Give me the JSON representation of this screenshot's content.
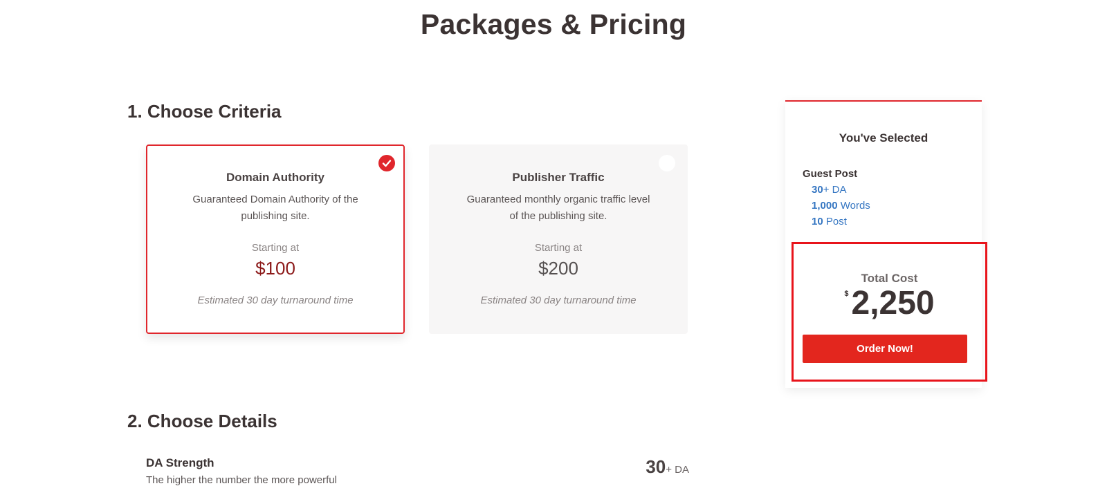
{
  "page": {
    "title": "Packages & Pricing"
  },
  "sections": {
    "criteria_title": "1. Choose Criteria",
    "details_title": "2. Choose Details"
  },
  "cards": [
    {
      "title": "Domain Authority",
      "description": "Guaranteed Domain Authority of the publishing site.",
      "starting_label": "Starting at",
      "price": "$100",
      "eta": "Estimated 30 day turnaround time",
      "selected": true,
      "check_icon": "checkmark-icon"
    },
    {
      "title": "Publisher Traffic",
      "description": "Guaranteed monthly organic traffic level of the publishing site.",
      "starting_label": "Starting at",
      "price": "$200",
      "eta": "Estimated 30 day turnaround time",
      "selected": false
    }
  ],
  "summary": {
    "title": "You've Selected",
    "product": "Guest Post",
    "lines": [
      {
        "value": "30",
        "unit": "+ DA"
      },
      {
        "value": "1,000",
        "unit": " Words"
      },
      {
        "value": "10",
        "unit": " Post"
      }
    ],
    "total_label": "Total Cost",
    "currency": "$",
    "total": "2,250",
    "order_button": "Order Now!"
  },
  "details": {
    "da_strength_label": "DA Strength",
    "da_strength_desc": "The higher the number the more powerful",
    "da_value": "30",
    "da_unit": "+ DA"
  },
  "colors": {
    "accent": "#e0262c",
    "link": "#3576c2",
    "price_selected": "#8c1a1a",
    "highlight_border": "#e8141b"
  }
}
